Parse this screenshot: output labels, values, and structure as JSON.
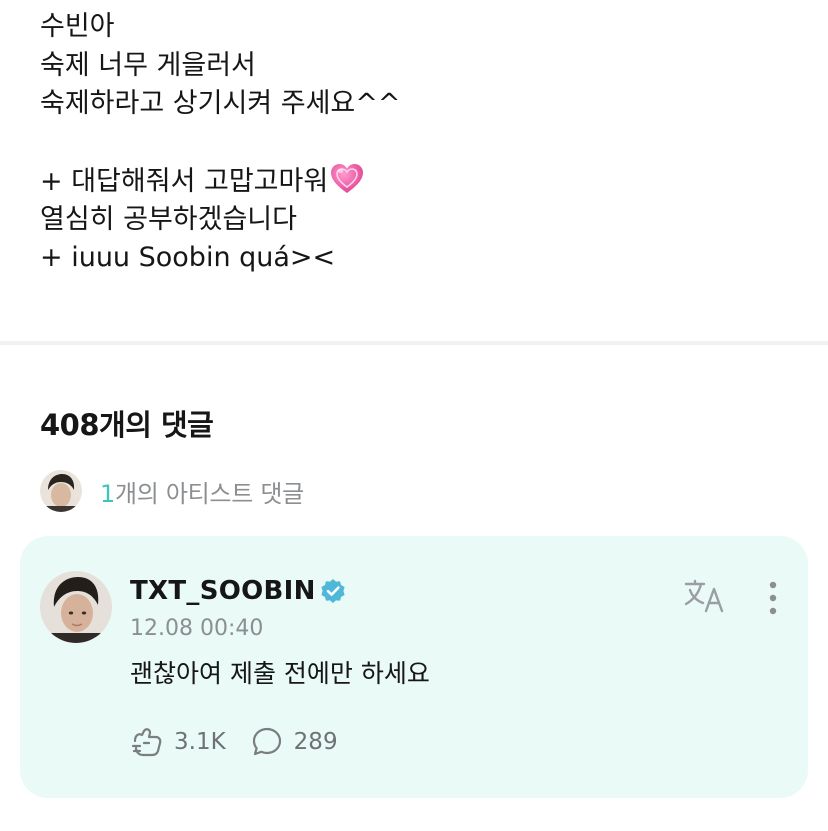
{
  "post": {
    "lines": [
      "수빈아",
      "숙제 너무 게을러서",
      "숙제하라고 상기시켜 주세요^^",
      "",
      "+ 대답해줘서 고맙고마워",
      "열심히 공부하겠습니다",
      "+ iuuu Soobin quá><"
    ],
    "heart_icon": "growing-heart-icon"
  },
  "comments_header": {
    "count_label": "408개의 댓글"
  },
  "artist_comments": {
    "count": "1",
    "label": "개의 아티스트 댓글",
    "accent_color": "#3fc4bc"
  },
  "artist_comment": {
    "author": "TXT_SOOBIN",
    "verified": true,
    "time": "12.08 00:40",
    "text": "괜찮아여 제출 전에만 하세요",
    "likes": "3.1K",
    "replies": "289",
    "card_color": "#e9faf7"
  }
}
